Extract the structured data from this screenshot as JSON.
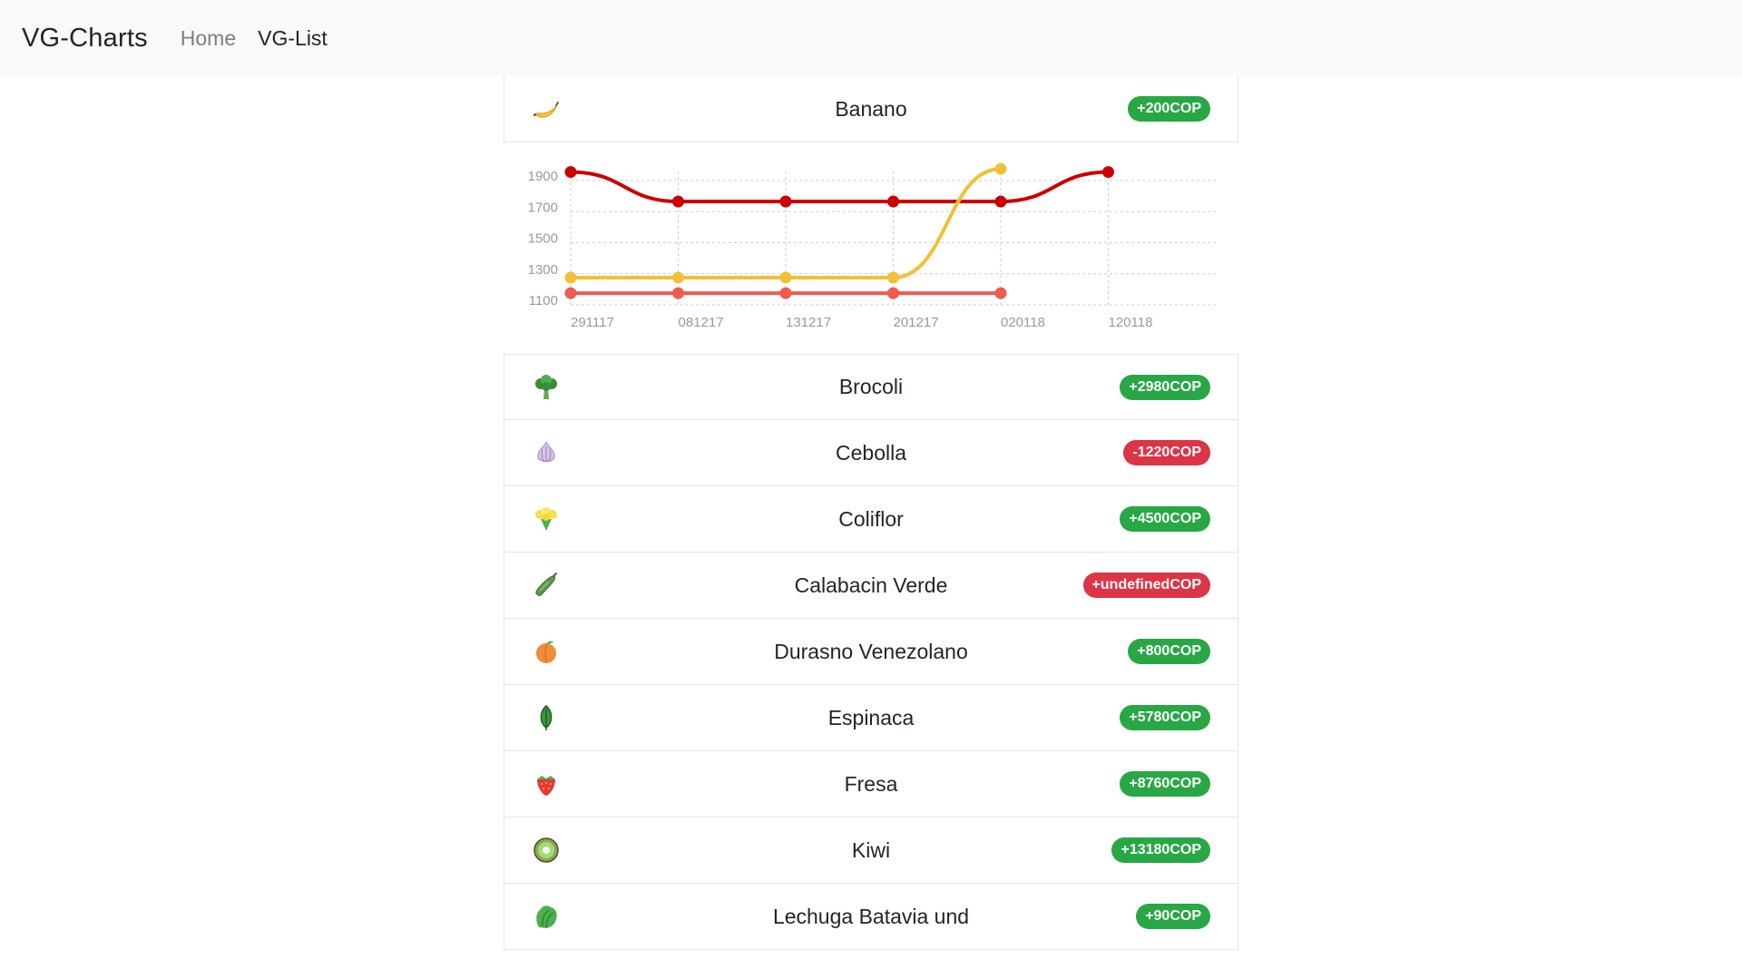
{
  "navbar": {
    "brand": "VG-Charts",
    "links": [
      "Home",
      "VG-List"
    ]
  },
  "colors": {
    "badge_positive": "#28a745",
    "badge_negative": "#dc3545",
    "series_dark_red": "#cc0000",
    "series_yellow": "#f2c037",
    "series_salmon": "#f05a4f"
  },
  "featured": {
    "name": "Banano",
    "icon": "banana-icon",
    "badge": "+200COP",
    "badge_status": "positive"
  },
  "chart_data": {
    "type": "line",
    "categories": [
      "291117",
      "081217",
      "131217",
      "201217",
      "020118",
      "120118"
    ],
    "yticks": [
      "1900",
      "1700",
      "1500",
      "1300",
      "1100"
    ],
    "ylim": [
      1100,
      1900
    ],
    "grid": true,
    "series": [
      {
        "color": "#cc0000",
        "values": [
          1920,
          1730,
          1730,
          1730,
          1730,
          1920
        ]
      },
      {
        "color": "#f2c037",
        "values": [
          1240,
          1240,
          1240,
          1240,
          1940,
          null
        ]
      },
      {
        "color": "#f05a4f",
        "values": [
          1140,
          1140,
          1140,
          1140,
          1140,
          null
        ]
      }
    ]
  },
  "items": [
    {
      "name": "Brocoli",
      "icon": "broccoli-icon",
      "badge": "+2980COP",
      "status": "positive"
    },
    {
      "name": "Cebolla",
      "icon": "onion-icon",
      "badge": "-1220COP",
      "status": "negative"
    },
    {
      "name": "Coliflor",
      "icon": "cauliflower-icon",
      "badge": "+4500COP",
      "status": "positive"
    },
    {
      "name": "Calabacin Verde",
      "icon": "zucchini-icon",
      "badge": "+undefinedCOP",
      "status": "negative"
    },
    {
      "name": "Durasno Venezolano",
      "icon": "peach-icon",
      "badge": "+800COP",
      "status": "positive"
    },
    {
      "name": "Espinaca",
      "icon": "spinach-leaf-icon",
      "badge": "+5780COP",
      "status": "positive"
    },
    {
      "name": "Fresa",
      "icon": "strawberry-icon",
      "badge": "+8760COP",
      "status": "positive"
    },
    {
      "name": "Kiwi",
      "icon": "kiwi-icon",
      "badge": "+13180COP",
      "status": "positive"
    },
    {
      "name": "Lechuga Batavia und",
      "icon": "lettuce-icon",
      "badge": "+90COP",
      "status": "positive"
    }
  ]
}
